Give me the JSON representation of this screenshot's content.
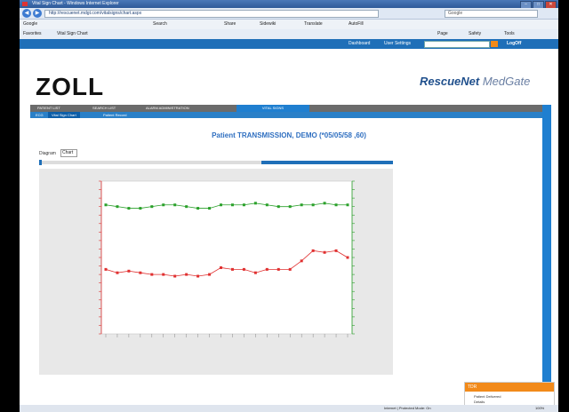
{
  "window": {
    "title": "Vital Sign Chart - Windows Internet Explorer"
  },
  "address": {
    "url": "http://rescuenet.mdgt.com/vitalsigns/chart.aspx",
    "search_placeholder": "Google"
  },
  "toolbar": {
    "google": "Google",
    "search": "Search",
    "share": "Share",
    "sidewiki": "Sidewiki",
    "translate": "Translate",
    "autofill": "AutoFill",
    "page": "Page",
    "safety": "Safety",
    "tools": "Tools"
  },
  "favorites": {
    "label": "Favorites",
    "tab": "Vital Sign Chart"
  },
  "topnav": {
    "links": [
      "Dashboard",
      "User Settings"
    ],
    "user": "LogOff"
  },
  "header": {
    "logo": "ZOLL",
    "brand": "RescueNet",
    "brand_suffix": "MedGate"
  },
  "menu": {
    "items": [
      "PATIENT LIST",
      "SEARCH LIST",
      "ALARM ADMINISTRATION",
      "VITAL SIGNS"
    ]
  },
  "submenu": {
    "items": [
      "ECG",
      "Vital Sign Chart",
      "Patient Record"
    ]
  },
  "page": {
    "title": "Patient TRANSMISSION, DEMO (*05/05/58 ,60)",
    "diagram_label": "Diagram",
    "diagram_value": "Chart"
  },
  "chart_data": {
    "type": "line",
    "y_left_label": "",
    "y_right_label": "",
    "series": [
      {
        "values": [
          96,
          95,
          94,
          94,
          95,
          96,
          96,
          95,
          94,
          94,
          96,
          96,
          96,
          97,
          96,
          95,
          95,
          96,
          96,
          97,
          96,
          96
        ],
        "color": "#2aa02a"
      },
      {
        "values": [
          58,
          56,
          57,
          56,
          55,
          55,
          54,
          55,
          54,
          55,
          59,
          58,
          58,
          56,
          58,
          58,
          58,
          63,
          69,
          68,
          69,
          65
        ],
        "color": "#e03030"
      }
    ],
    "ylim": [
      20,
      110
    ],
    "grid": true
  },
  "notification": {
    "header": "TDR",
    "rows": [
      "Patient Delivered",
      "Details"
    ]
  },
  "status": {
    "zone": "Internet | Protected Mode: On",
    "zoom": "100%"
  },
  "colors": {
    "accent": "#1f7fd0",
    "brand_orange": "#f28a1a"
  }
}
